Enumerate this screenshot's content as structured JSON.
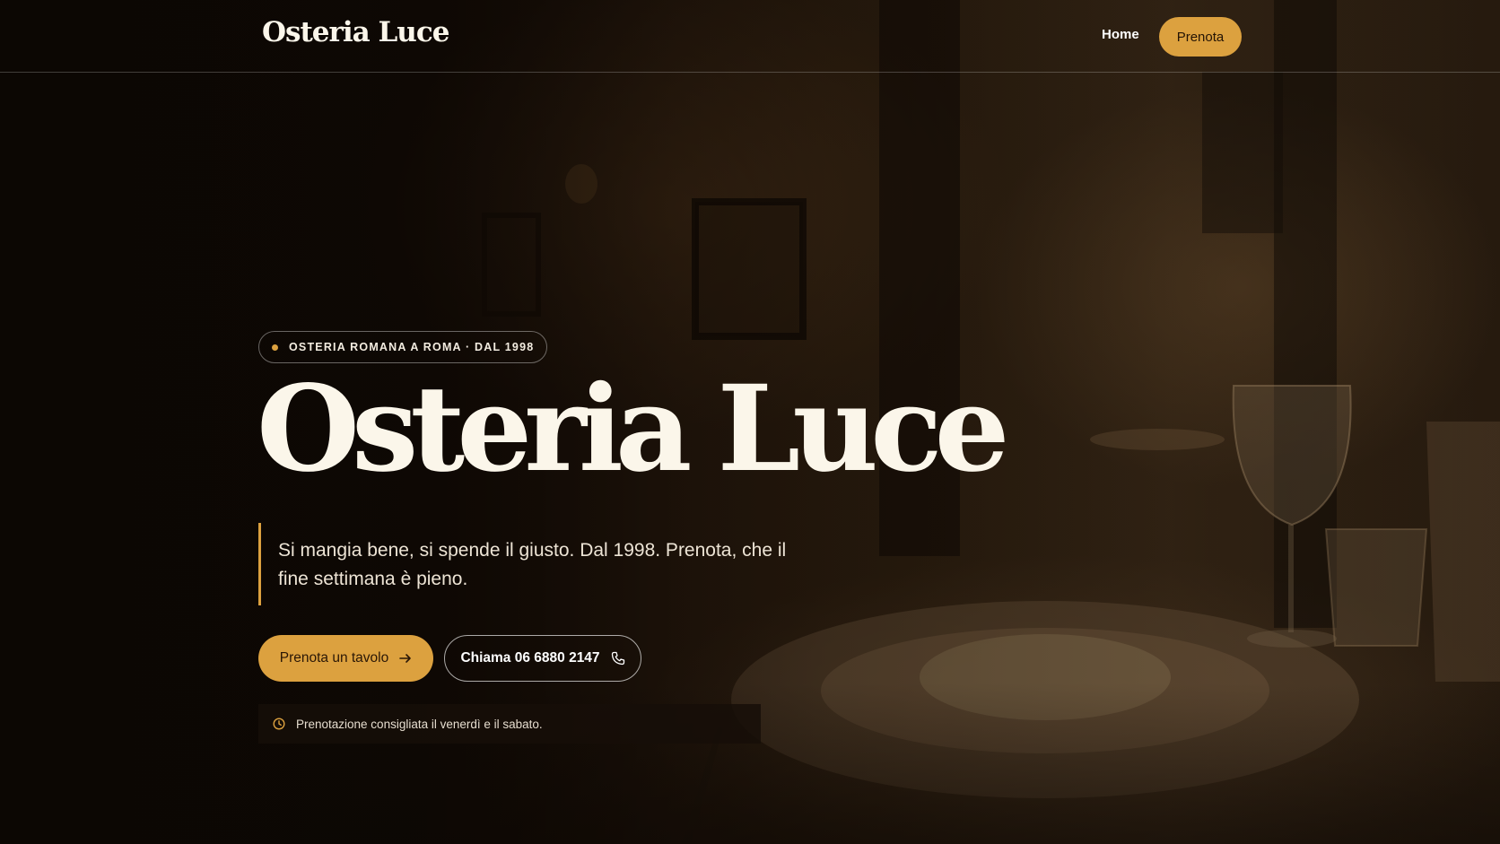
{
  "header": {
    "logo": "Osteria Luce",
    "nav": {
      "home_label": "Home",
      "cta_label": "Prenota"
    }
  },
  "hero": {
    "badge": "OSTERIA ROMANA A ROMA · DAL 1998",
    "title": "Osteria Luce",
    "tagline": "Si mangia bene, si spende il giusto. Dal 1998. Prenota, che il fine settimana è pieno.",
    "primary_button": {
      "label": "Prenota un tavolo",
      "icon": "arrow-right-icon"
    },
    "secondary_button": {
      "label": "Chiama 06 6880 2147",
      "icon": "phone-icon"
    },
    "notice": {
      "text": "Prenotazione consigliata il venerdì e il sabato.",
      "icon": "clock-icon"
    }
  },
  "colors": {
    "accent": "#dca13f",
    "text_light": "#fbf6ea",
    "background": "#120b06"
  }
}
